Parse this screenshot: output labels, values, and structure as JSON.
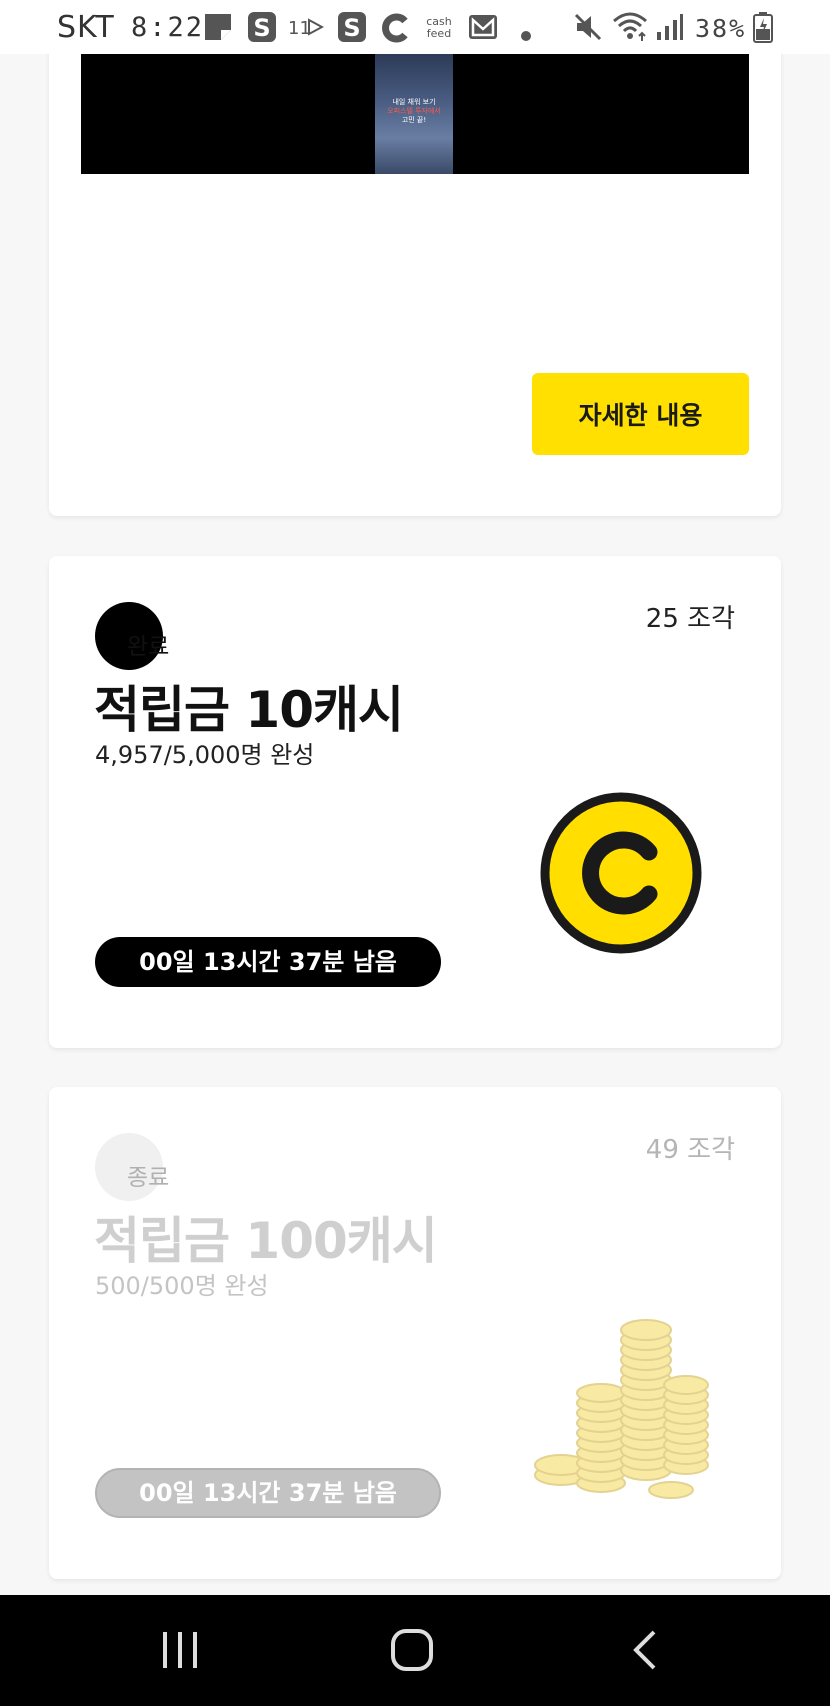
{
  "status_bar": {
    "carrier": "SKT",
    "time": "8:22",
    "battery": "38%",
    "icons": [
      "notes-icon",
      "s-app-icon",
      "11st-icon",
      "s-app-icon",
      "c-app-icon",
      "cashfeed-icon",
      "gmail-icon",
      "dot-icon",
      "mute-icon",
      "wifi-icon",
      "signal-icon",
      "battery-icon"
    ],
    "cashfeed_label": "cash feed",
    "eleven_label": "11"
  },
  "promo_card": {
    "video_caption_line1": "내일 채워 보기",
    "video_caption_line2": "오피스텔 투자에서",
    "video_caption_line3": "고민 끝!",
    "detail_button": "자세한 내용"
  },
  "cards": [
    {
      "pieces": "25 조각",
      "badge": "완료",
      "title": "적립금 10캐시",
      "progress": "4,957/5,000명 완성",
      "timer": "00일 13시간 37분 남음",
      "icon": "cash-coin-icon",
      "state": "active"
    },
    {
      "pieces": "49 조각",
      "badge": "종료",
      "title": "적립금 100캐시",
      "progress": "500/500명 완성",
      "timer": "00일 13시간 37분 남음",
      "icon": "coin-stack-icon",
      "state": "ended"
    }
  ],
  "colors": {
    "accent_yellow": "#FFE000",
    "coin_yellow": "#FFDE00",
    "text_dark": "#111111",
    "disabled_gray": "#C3C3C3"
  },
  "nav_bar": {
    "buttons": [
      "recents-icon",
      "home-icon",
      "back-icon"
    ]
  }
}
